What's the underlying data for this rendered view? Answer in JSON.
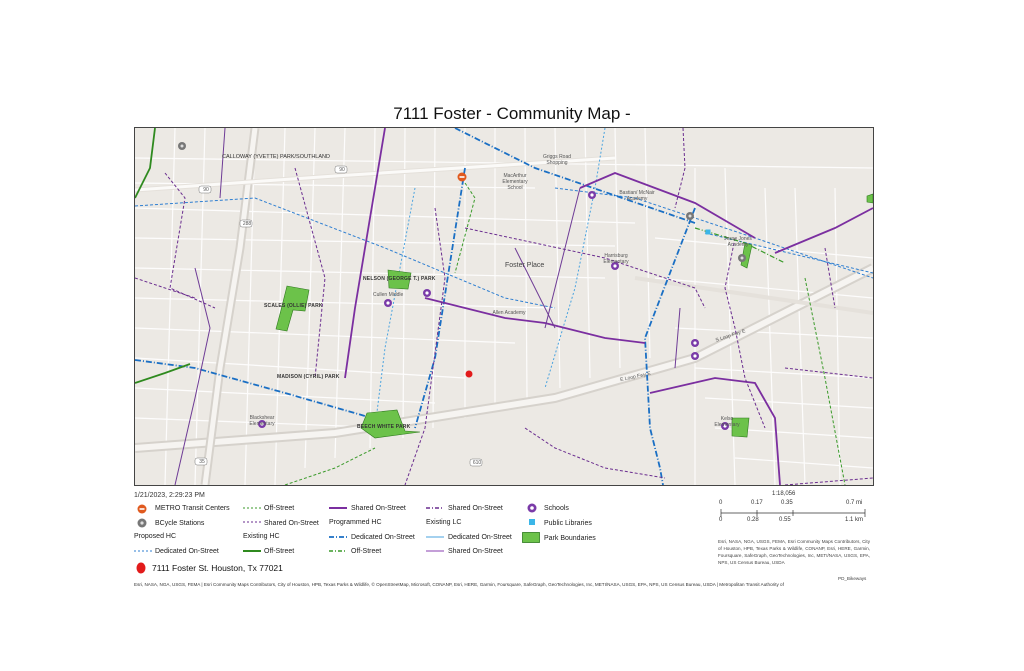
{
  "title": "7111 Foster - Community Map -",
  "timestamp": "1/21/2023, 2:29:23 PM",
  "map_labels": {
    "calloway": "CALLOWAY (YVETTE) PARK/SOUTHLAND",
    "nelson": "NELSON (GEORGE T.) PARK",
    "scales": "SCALES (OLLIE) PARK",
    "madison": "MADISON (CYRIL) PARK",
    "beech": "BEECH WHITE PARK",
    "foster_place": "Foster Place",
    "macarthur": "MacArthur Elementary School",
    "mcnair": "Bastian/ McNair Academy",
    "jesse": "Jesse Jones Academy",
    "harrisburg": "Harrisburg Elementary",
    "cullen": "Cullen Middle",
    "blackshear": "Blackshear Elementary",
    "kelso": "Kelso Elementary",
    "griggs": "Griggs Road Shopping",
    "allen": "Allen Academy",
    "loop_e_1": "S Loop Fwy E",
    "loop_e_2": "E Loop Fwy E",
    "road_90": "90",
    "road_288": "288",
    "road_610": "610",
    "road_35": "35"
  },
  "legend": {
    "metro": "METRO Transit Centers",
    "bcycle": "BCycle Stations",
    "proposed_hc": "Proposed HC",
    "proposed_hc_dedicated": "Dedicated On-Street",
    "col2_offstreet": "Off-Street",
    "col2_shared": "Shared On-Street",
    "existing_hc": "Existing HC",
    "existing_hc_offstreet": "Off-Street",
    "col3_shared": "Shared On-Street",
    "programmed_hc": "Programmed HC",
    "programmed_hc_dedicated": "Dedicated On-Street",
    "programmed_hc_offstreet": "Off-Street",
    "col4_shared": "Shared On-Street",
    "existing_lc": "Existing LC",
    "existing_lc_dedicated": "Dedicated On-Street",
    "existing_lc_shared": "Shared On-Street",
    "schools": "Schools",
    "libraries": "Public Libraries",
    "parks": "Park Boundaries",
    "address": "7111 Foster St. Houston, Tx 77021"
  },
  "scale": {
    "ratio": "1:18,056",
    "mi_ticks": [
      "0",
      "0.17",
      "0.35",
      "0.7 mi"
    ],
    "km_ticks": [
      "0",
      "0.28",
      "0.55",
      "1.1 km"
    ]
  },
  "attribution_right": "Esri, NASA, NGA, USGS, FEMA, Esri Community Maps Contributors, City of Houston, HPB, Texas Parks & Wildlife, CONANP, Esri, HERE, Garmin, Foursquare, SafeGraph, GeoTechnologies, Inc, METI/NASA, USGS, EPA, NPS, US Census Bureau, USDA",
  "pd_label": "PD_Bikeways",
  "footer": "Esri, NASA, NGA, USGS, FEMA | Esri Community Maps Contributors, City of Houston, HPB, Texas Parks & Wildlife, © OpenStreetMap, Microsoft, CONANP, Esri, HERE, Garmin, Foursquare, SafeGraph, GeoTechnologies, Inc, METI/NASA, USGS, EPA, NPS, US Census Bureau, USDA | Metropolitan Transit Authority of",
  "colors": {
    "shared_onstreet_purple": "#7b2fa0",
    "programmed_blue": "#1a6fc4",
    "offstreet_green": "#3a9a2a",
    "park_green": "#6cc24a",
    "school_purple": "#7a3aa8",
    "metro_red": "#e05a1f",
    "bcycle_gray": "#777777",
    "address_red": "#e21b1b",
    "map_bg": "#ece9e4"
  }
}
